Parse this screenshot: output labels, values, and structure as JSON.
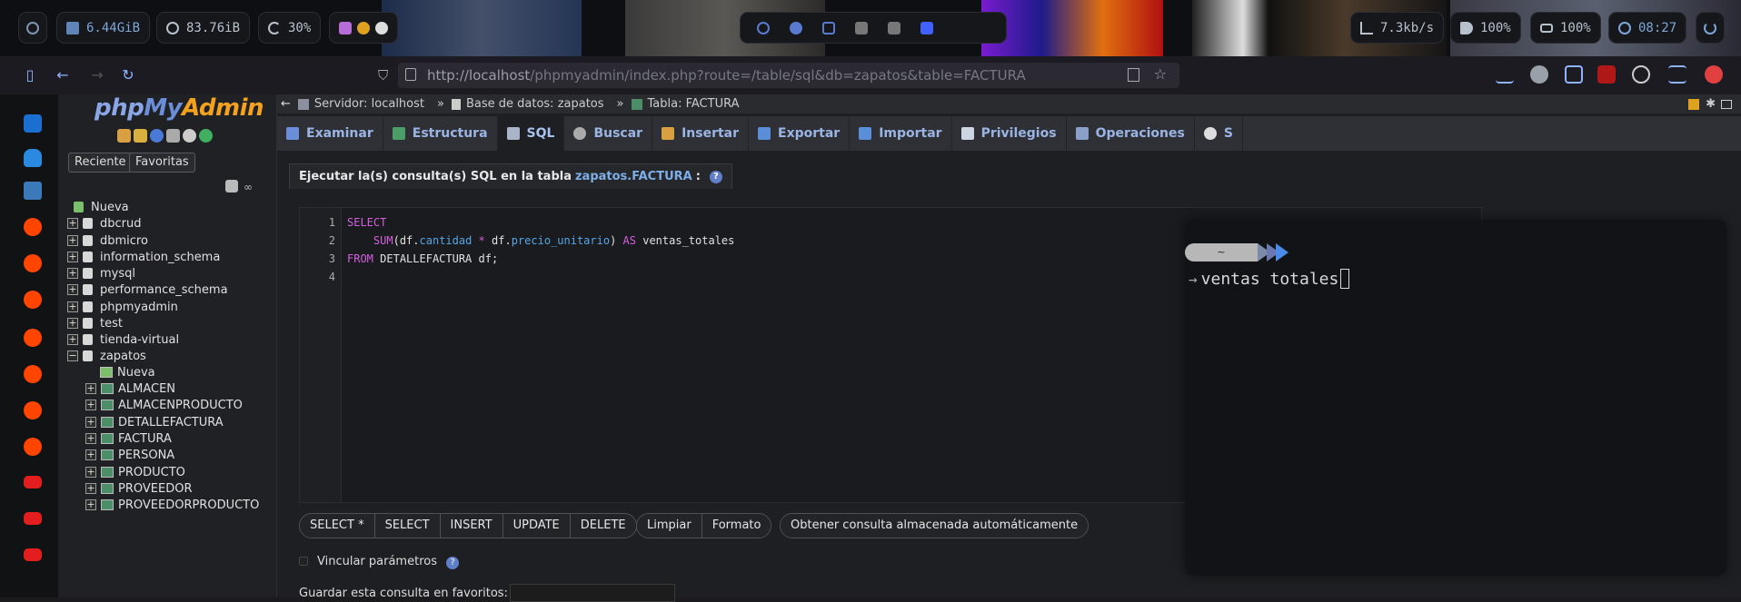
{
  "topbar": {
    "mem": "6.44GiB",
    "disk": "83.76iB",
    "cpu": "30%",
    "net": "7.3kb/s",
    "volume": "100%",
    "battery": "100%",
    "clock": "08:27"
  },
  "browser": {
    "url_prefix": "http://localhost",
    "url_rest": "/phpmyadmin/index.php?route=/table/sql&db=zapatos&table=FACTURA"
  },
  "sidebar": {
    "logo_php": "php",
    "logo_my": "My",
    "logo_admin": "Admin",
    "recent_label": "Reciente",
    "favorites_label": "Favoritas",
    "tree": [
      {
        "label": "Nueva",
        "kind": "new"
      },
      {
        "label": "dbcrud",
        "kind": "db"
      },
      {
        "label": "dbmicro",
        "kind": "db"
      },
      {
        "label": "information_schema",
        "kind": "db"
      },
      {
        "label": "mysql",
        "kind": "db"
      },
      {
        "label": "performance_schema",
        "kind": "db"
      },
      {
        "label": "phpmyadmin",
        "kind": "db"
      },
      {
        "label": "test",
        "kind": "db"
      },
      {
        "label": "tienda-virtual",
        "kind": "db"
      },
      {
        "label": "zapatos",
        "kind": "db-open"
      },
      {
        "label": "Nueva",
        "kind": "table-new"
      },
      {
        "label": "ALMACEN",
        "kind": "table"
      },
      {
        "label": "ALMACENPRODUCTO",
        "kind": "table"
      },
      {
        "label": "DETALLEFACTURA",
        "kind": "table"
      },
      {
        "label": "FACTURA",
        "kind": "table"
      },
      {
        "label": "PERSONA",
        "kind": "table"
      },
      {
        "label": "PRODUCTO",
        "kind": "table"
      },
      {
        "label": "PROVEEDOR",
        "kind": "table"
      },
      {
        "label": "PROVEEDORPRODUCTO",
        "kind": "table"
      }
    ]
  },
  "breadcrumb": {
    "server": "Servidor: localhost",
    "sep": "»",
    "database": "Base de datos: zapatos",
    "table": "Tabla: FACTURA"
  },
  "tabs": [
    {
      "label": "Examinar"
    },
    {
      "label": "Estructura"
    },
    {
      "label": "SQL"
    },
    {
      "label": "Buscar"
    },
    {
      "label": "Insertar"
    },
    {
      "label": "Exportar"
    },
    {
      "label": "Importar"
    },
    {
      "label": "Privilegios"
    },
    {
      "label": "Operaciones"
    },
    {
      "label": "S"
    }
  ],
  "query": {
    "header_prefix": "Ejecutar la(s) consulta(s) SQL en la tabla ",
    "header_table": "zapatos.FACTURA",
    "header_suffix": ":",
    "line_numbers": [
      "1",
      "2",
      "3",
      "4"
    ],
    "lines": {
      "l1_kw": "SELECT",
      "l2_fn": "SUM",
      "l2_a": "df",
      "l2_b": "cantidad",
      "l2_c": "df",
      "l2_d": "precio_unitario",
      "l2_as": "AS",
      "l2_alias": "ventas_totales",
      "l3_kw": "FROM",
      "l3_rest": "DETALLEFACTURA df;"
    }
  },
  "buttons": {
    "group1": [
      "SELECT *",
      "SELECT",
      "INSERT",
      "UPDATE",
      "DELETE"
    ],
    "group2": [
      "Limpiar",
      "Formato"
    ],
    "auto": "Obtener consulta almacenada automáticamente",
    "collapse": "<<"
  },
  "options": {
    "bind_params": "Vincular parámetros",
    "save_fav": "Guardar esta consulta en favoritos:"
  },
  "terminal": {
    "home": "~",
    "arrow": "→",
    "input": "ventas totales"
  }
}
